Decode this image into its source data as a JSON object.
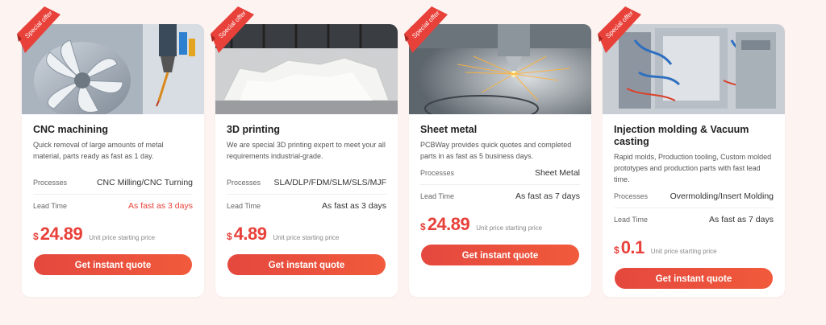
{
  "colors": {
    "accent": "#e8413a",
    "button": "#ec4a3d",
    "page_bg": "#fdf3f1"
  },
  "cards": [
    {
      "badge": "Special offer",
      "title": "CNC machining",
      "description": "Quick removal of large amounts of metal material, parts ready as fast as 1 day.",
      "processes_label": "Processes",
      "processes_value": "CNC Milling/CNC Turning",
      "lead_label": "Lead Time",
      "lead_value": "As fast as 3 days",
      "currency": "$",
      "price": "24.89",
      "price_note": "Unit price starting price",
      "button": "Get instant quote",
      "image": "cnc-machining-photo"
    },
    {
      "badge": "Special offer",
      "title": "3D printing",
      "description": "We are special 3D printing expert to meet your all requirements industrial-grade.",
      "processes_label": "Processes",
      "processes_value": "SLA/DLP/FDM/SLM/SLS/MJF",
      "lead_label": "Lead Time",
      "lead_value": "As fast as 3 days",
      "currency": "$",
      "price": "4.89",
      "price_note": "Unit price starting price",
      "button": "Get instant quote",
      "image": "3d-printing-photo"
    },
    {
      "badge": "Special offer",
      "title": "Sheet metal",
      "description": "PCBWay provides quick quotes and completed parts in as fast as 5 business days.",
      "processes_label": "Processes",
      "processes_value": "Sheet Metal",
      "lead_label": "Lead Time",
      "lead_value": "As fast as 7 days",
      "currency": "$",
      "price": "24.89",
      "price_note": "Unit price starting price",
      "button": "Get instant quote",
      "image": "sheet-metal-laser-photo"
    },
    {
      "badge": "Special offer",
      "title": "Injection molding & Vacuum casting",
      "description": "Rapid molds, Production tooling, Custom molded prototypes and production parts with fast lead time.",
      "processes_label": "Processes",
      "processes_value": "Overmolding/Insert Molding",
      "lead_label": "Lead Time",
      "lead_value": "As fast as 7 days",
      "currency": "$",
      "price": "0.1",
      "price_note": "Unit price starting price",
      "button": "Get instant quote",
      "image": "injection-molding-machine-photo"
    }
  ]
}
